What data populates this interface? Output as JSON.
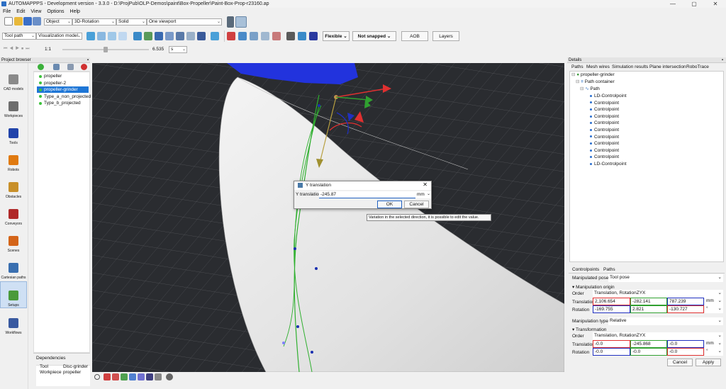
{
  "window": {
    "title": "AUTOMAPPPS - Development version - 3.3.0 - D:\\ProjPub\\OLP-Demos\\paint\\Box-Propeller\\Paint-Box-Prop-r23160.ap",
    "minimize": "—",
    "maximize": "▢",
    "close": "✕"
  },
  "menu": [
    "File",
    "Edit",
    "View",
    "Options",
    "Help"
  ],
  "toolbar": {
    "select_mode": "Object",
    "manipulator": "3D-Rotation",
    "shading": "Solid",
    "viewport": "One viewport",
    "tool_path": "Tool path",
    "visualization_model": "Visualization model",
    "flexible": "Flexible",
    "not_snapped": "Not snapped",
    "aob": "AOB",
    "layers": "Layers",
    "speed_ratio": "1:1",
    "time_value": "6.535",
    "time_unit": "s"
  },
  "project_browser": {
    "header": "Project browser",
    "tools": [
      {
        "label": "CAD models",
        "icon": "cad-models-icon",
        "color": "#8a8a8a"
      },
      {
        "label": "Workpieces",
        "icon": "workpieces-icon",
        "color": "#6e6e6e"
      },
      {
        "label": "Tools",
        "icon": "tools-icon",
        "color": "#2244aa"
      },
      {
        "label": "Robots",
        "icon": "robots-icon",
        "color": "#e07a10"
      },
      {
        "label": "Obstacles",
        "icon": "obstacles-icon",
        "color": "#c8902a"
      },
      {
        "label": "Conveyors",
        "icon": "conveyors-icon",
        "color": "#b02a2a"
      },
      {
        "label": "Scenes",
        "icon": "scenes-icon",
        "color": "#d4651a"
      },
      {
        "label": "Cartesian paths",
        "icon": "cartesian-paths-icon",
        "color": "#3a6fb0"
      },
      {
        "label": "Setups",
        "icon": "setups-icon",
        "color": "#4a9a3a"
      },
      {
        "label": "Workflows",
        "icon": "workflows-icon",
        "color": "#3a5aa0"
      }
    ],
    "items": [
      "propeller",
      "propeller-2",
      "propeller-grinder",
      "Type_a_non_projected",
      "Type_b_projected"
    ],
    "selected_index": 2,
    "dependencies": {
      "title": "Dependencies",
      "rows": [
        {
          "key": "Tool",
          "value": "Disc-grinder"
        },
        {
          "key": "Workpiece",
          "value": "propeller"
        }
      ]
    }
  },
  "dialog": {
    "title": "Y translation",
    "label": "Y translation",
    "value": "-245.87",
    "unit": "mm",
    "ok": "OK",
    "cancel": "Cancel",
    "tooltip": "Variation in the selected direction, it is possible to edit the value."
  },
  "details": {
    "header": "Details",
    "tabs": [
      "Paths",
      "Mesh wires",
      "Simulation results",
      "Plane intersection",
      "RoboTrace"
    ],
    "tree": {
      "root": "propeller-grinder",
      "container": "Path container",
      "path": "Path",
      "points": [
        "LD-Controlpoint",
        "Controlpoint",
        "Controlpoint",
        "Controlpoint",
        "Controlpoint",
        "Controlpoint",
        "Controlpoint",
        "Controlpoint",
        "Controlpoint",
        "Controlpoint",
        "LD-Controlpoint"
      ]
    },
    "sub_tabs": [
      "Controlpoints",
      "Paths"
    ],
    "manipulated_pose_label": "Manipulated pose",
    "manipulated_pose": "Tool pose",
    "manipulation_origin": "Manipulation origin",
    "order_label": "Order",
    "order": "Translation, RotationZYX",
    "translation_label": "Translation",
    "rotation_label": "Rotation",
    "origin_translation": [
      "2,106.654",
      "-282.141",
      "787.239"
    ],
    "origin_rotation": [
      "-169.755",
      "2.821",
      "-130.727"
    ],
    "unit_mm": "mm",
    "unit_deg": "°",
    "manipulation_type_label": "Manipulation type",
    "manipulation_type": "Relative",
    "transformation": "Transformation",
    "trans_order": "Translation, RotationZYX",
    "trans_translation": [
      "-0.0",
      "-245.868",
      "-0.0"
    ],
    "trans_rotation": [
      "-0.0",
      "-0.0",
      "-0.0"
    ],
    "cancel": "Cancel",
    "apply": "Apply"
  },
  "colors": {
    "x_axis": "#e03030",
    "y_axis": "#30a030",
    "z_axis": "#2030c0",
    "selection": "#1e76d6",
    "path_green": "#2fb02f"
  }
}
